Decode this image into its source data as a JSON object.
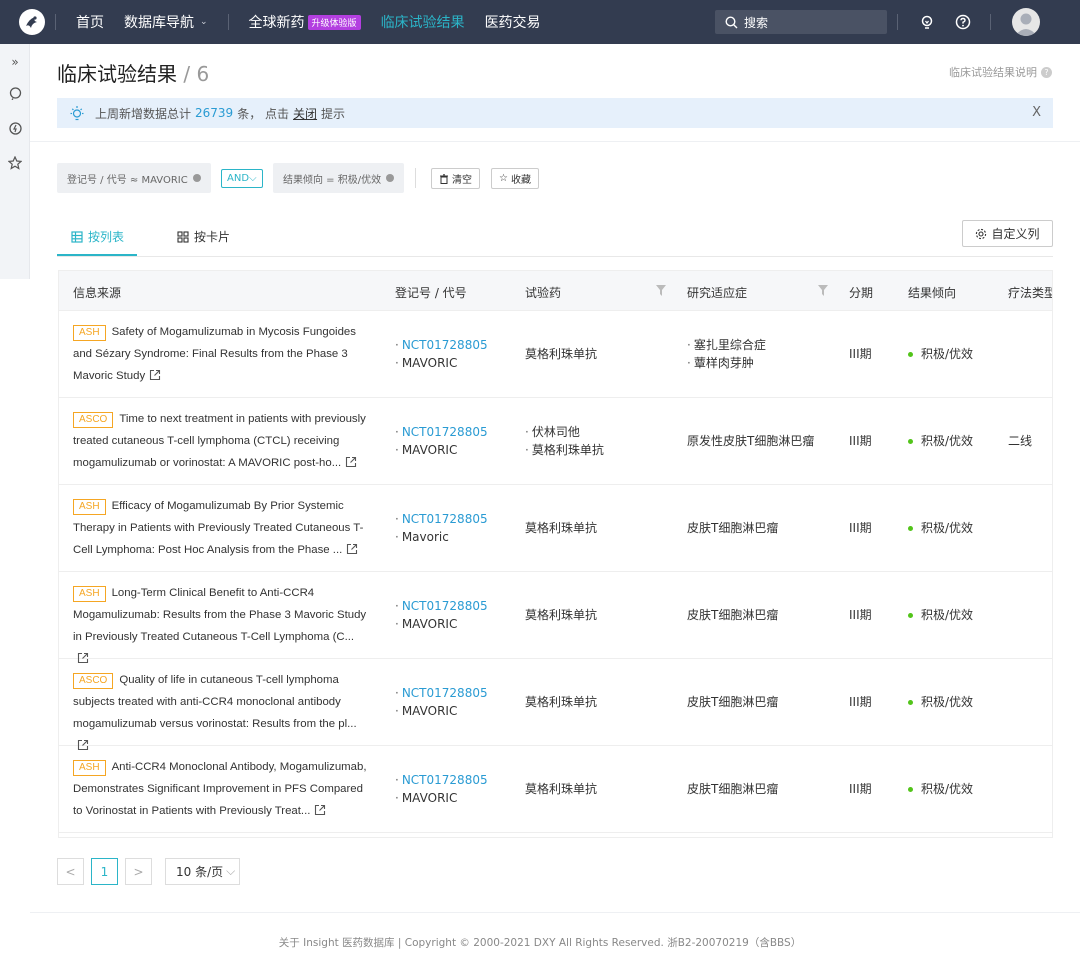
{
  "nav": {
    "home": "首页",
    "db_nav": "数据库导航",
    "global_drugs": "全球新药",
    "upgrade_badge": "升级体验版",
    "clinical_results": "临床试验结果",
    "pharma_trade": "医药交易",
    "search_placeholder": "搜索"
  },
  "page": {
    "title": "临床试验结果",
    "count": " / 6",
    "help_text": "临床试验结果说明"
  },
  "notice": {
    "prefix": "上周新增数据总计",
    "number": "26739",
    "middle": "条，  点击",
    "close_link": "关闭",
    "suffix": "提示",
    "dismiss": "X"
  },
  "filters": {
    "chip1": "登记号 / 代号 ≈ MAVORIC",
    "operator": "AND",
    "chip2": "结果倾向 = 积极/优效",
    "clear": "清空",
    "favorite": "收藏"
  },
  "tabs": {
    "list": "按列表",
    "card": "按卡片",
    "custom_columns": "自定义列"
  },
  "table": {
    "headers": {
      "source": "信息来源",
      "reg_no": "登记号 / 代号",
      "drug": "试验药",
      "indication": "研究适应症",
      "phase": "分期",
      "result": "结果倾向",
      "therapy": "疗法类型"
    },
    "rows": [
      {
        "tag": "ASH",
        "title": "Safety of Mogamulizumab in Mycosis Fungoides and Sézary Syndrome: Final Results from the Phase 3 Mavoric Study",
        "reg1": "NCT01728805",
        "reg2": "MAVORIC",
        "drugs": [
          "莫格利珠单抗"
        ],
        "indications": [
          "塞扎里综合症",
          "蕈样肉芽肿"
        ],
        "phase": "III期",
        "result": "积极/优效",
        "therapy": ""
      },
      {
        "tag": "ASCO",
        "title": "Time to next treatment in patients with previously treated cutaneous T-cell lymphoma (CTCL) receiving mogamulizumab or vorinostat: A MAVORIC post-ho...",
        "reg1": "NCT01728805",
        "reg2": "MAVORIC",
        "drugs": [
          "伏林司他",
          "莫格利珠单抗"
        ],
        "indications": [
          "原发性皮肤T细胞淋巴瘤"
        ],
        "phase": "III期",
        "result": "积极/优效",
        "therapy": "二线"
      },
      {
        "tag": "ASH",
        "title": "Efficacy of Mogamulizumab By Prior Systemic Therapy in Patients with Previously Treated Cutaneous T-Cell Lymphoma: Post Hoc Analysis from the Phase ...",
        "reg1": "NCT01728805",
        "reg2": "Mavoric",
        "drugs": [
          "莫格利珠单抗"
        ],
        "indications": [
          "皮肤T细胞淋巴瘤"
        ],
        "phase": "III期",
        "result": "积极/优效",
        "therapy": ""
      },
      {
        "tag": "ASH",
        "title": "Long-Term Clinical Benefit to Anti-CCR4 Mogamulizumab: Results from the Phase 3 Mavoric Study in Previously Treated Cutaneous T-Cell Lymphoma (C...",
        "reg1": "NCT01728805",
        "reg2": "MAVORIC",
        "drugs": [
          "莫格利珠单抗"
        ],
        "indications": [
          "皮肤T细胞淋巴瘤"
        ],
        "phase": "III期",
        "result": "积极/优效",
        "therapy": ""
      },
      {
        "tag": "ASCO",
        "title": "Quality of life in cutaneous T-cell lymphoma subjects treated with anti-CCR4 monoclonal antibody mogamulizumab versus vorinostat: Results from the pl...",
        "reg1": "NCT01728805",
        "reg2": "MAVORIC",
        "drugs": [
          "莫格利珠单抗"
        ],
        "indications": [
          "皮肤T细胞淋巴瘤"
        ],
        "phase": "III期",
        "result": "积极/优效",
        "therapy": ""
      },
      {
        "tag": "ASH",
        "title": "Anti-CCR4 Monoclonal Antibody, Mogamulizumab, Demonstrates Significant Improvement in PFS Compared to Vorinostat in Patients with Previously Treat...",
        "reg1": "NCT01728805",
        "reg2": "MAVORIC",
        "drugs": [
          "莫格利珠单抗"
        ],
        "indications": [
          "皮肤T细胞淋巴瘤"
        ],
        "phase": "III期",
        "result": "积极/优效",
        "therapy": ""
      }
    ]
  },
  "pagination": {
    "prev": "<",
    "current": "1",
    "next": ">",
    "page_size": "10 条/页"
  },
  "footer": {
    "text": "关于 Insight 医药数据库  |  Copyright © 2000-2021 DXY All Rights Reserved. 浙B2-20070219（含BBS）"
  },
  "colors": {
    "topbar": "#333c50",
    "accent": "#2bb5c8",
    "link": "#2a9bd3",
    "tag": "#f5a623",
    "positive": "#52c41a",
    "upgrade_badge": "#b33fe0"
  }
}
